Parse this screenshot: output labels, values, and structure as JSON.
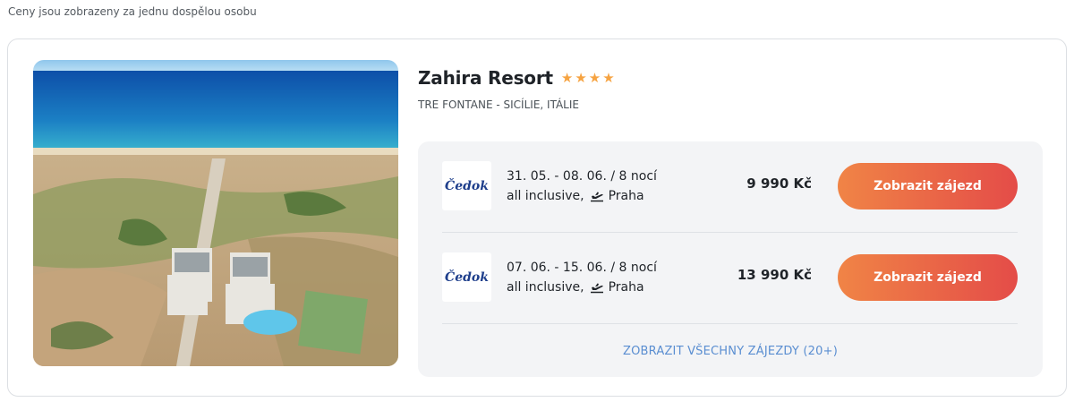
{
  "note": "Ceny jsou zobrazeny za jednu dospělou osobu",
  "hotel": {
    "name": "Zahira Resort",
    "stars": 4,
    "location": "TRE FONTANE - SICÍLIE, ITÁLIE"
  },
  "offers": [
    {
      "operator": "Čedok",
      "dates": "31. 05. - 08. 06. / 8 nocí",
      "meal": "all inclusive,",
      "departure": "Praha",
      "price": "9 990 Kč",
      "button_label": "Zobrazit zájezd"
    },
    {
      "operator": "Čedok",
      "dates": "07. 06. - 15. 06. / 8 nocí",
      "meal": "all inclusive,",
      "departure": "Praha",
      "price": "13 990 Kč",
      "button_label": "Zobrazit zájezd"
    }
  ],
  "all_trips_link": "ZOBRAZIT VŠECHNY ZÁJEZDY (20+)",
  "colors": {
    "accent_start": "#f08446",
    "accent_end": "#e44c48",
    "star": "#f6a341",
    "link": "#5a8ed1"
  }
}
